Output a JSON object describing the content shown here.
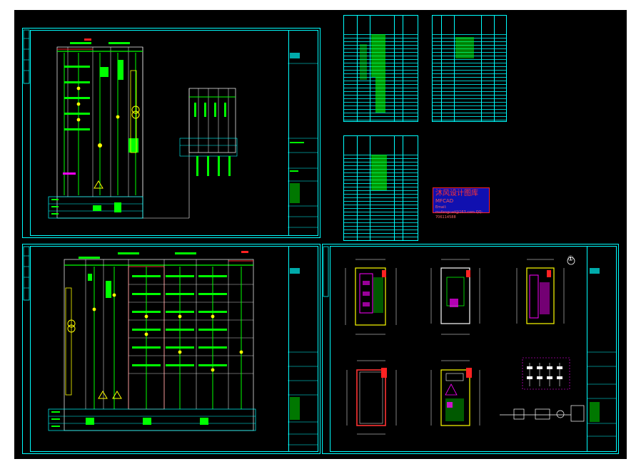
{
  "watermark": {
    "line1": "沐风设计图库",
    "line2": "MFCAD",
    "line3": "Email: mufengcad@163.com  QQ: 706114588"
  },
  "sheets": [
    {
      "id": "sheet-1",
      "label": "primary-diagram-sheet-top"
    },
    {
      "id": "sheet-2",
      "label": "primary-diagram-sheet-bottom"
    },
    {
      "id": "sheet-3",
      "label": "layout-sheet"
    }
  ],
  "colors": {
    "background": "#000000",
    "frame": "#00ffff",
    "wiring": "#00ff00",
    "device": "#ffff00",
    "highlight": "#ff00ff",
    "accent": "#ff2222"
  },
  "north_arrow": "①"
}
